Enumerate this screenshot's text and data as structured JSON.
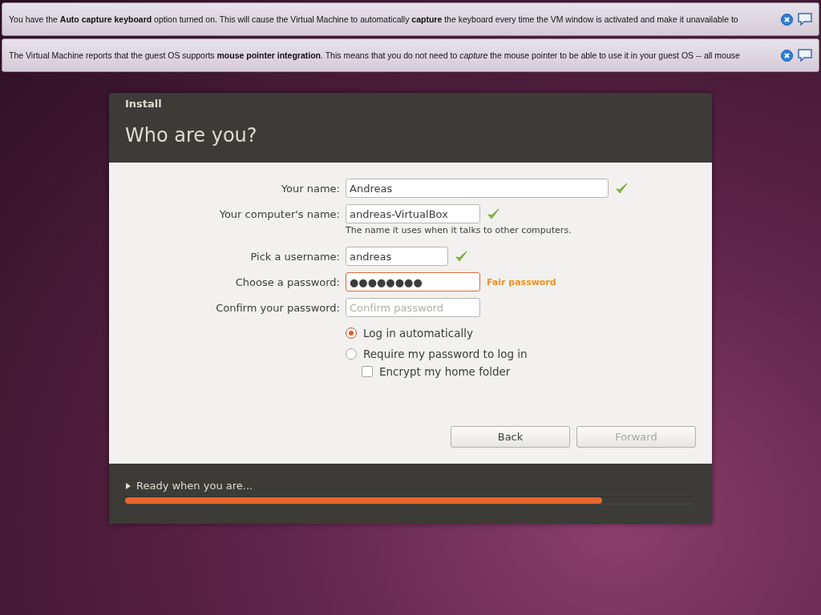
{
  "notifications": [
    {
      "text": "You have the **Auto capture keyboard** option turned on. This will cause the Virtual Machine to automatically **capture** the keyboard every time the VM window is activated and make it unavailable to"
    },
    {
      "text": "The Virtual Machine reports that the guest OS supports **mouse pointer integration**. This means that you do not need to *capture* the mouse pointer to be able to use it in your guest OS -- all mouse"
    }
  ],
  "window": {
    "title": "Install",
    "heading": "Who are you?"
  },
  "fields": [
    {
      "label": "Your name:",
      "value": "Andreas",
      "kind": "wide",
      "valid": true,
      "focused": false
    },
    {
      "label": "Your computer's name:",
      "value": "andreas-VirtualBox",
      "kind": "medium",
      "valid": true,
      "focused": false,
      "hint": "The name it uses when it talks to other computers."
    },
    {
      "label": "Pick a username:",
      "value": "andreas",
      "kind": "short",
      "valid": true,
      "focused": false
    },
    {
      "label": "Choose a password:",
      "value": "●●●●●●●●",
      "kind": "medium",
      "valid": false,
      "focused": true,
      "strength": "Fair password"
    },
    {
      "label": "Confirm your password:",
      "placeholder": "Confirm password",
      "kind": "medium",
      "valid": false,
      "focused": false
    }
  ],
  "login_options": [
    {
      "label": "Log in automatically",
      "selected": true
    },
    {
      "label": "Require my password to log in",
      "selected": false
    }
  ],
  "encrypt": {
    "label": "Encrypt my home folder",
    "checked": false
  },
  "buttons": [
    {
      "label": "Back",
      "disabled": false
    },
    {
      "label": "Forward",
      "disabled": true
    }
  ],
  "progress": {
    "label": "Ready when you are...",
    "level": 0.84
  }
}
